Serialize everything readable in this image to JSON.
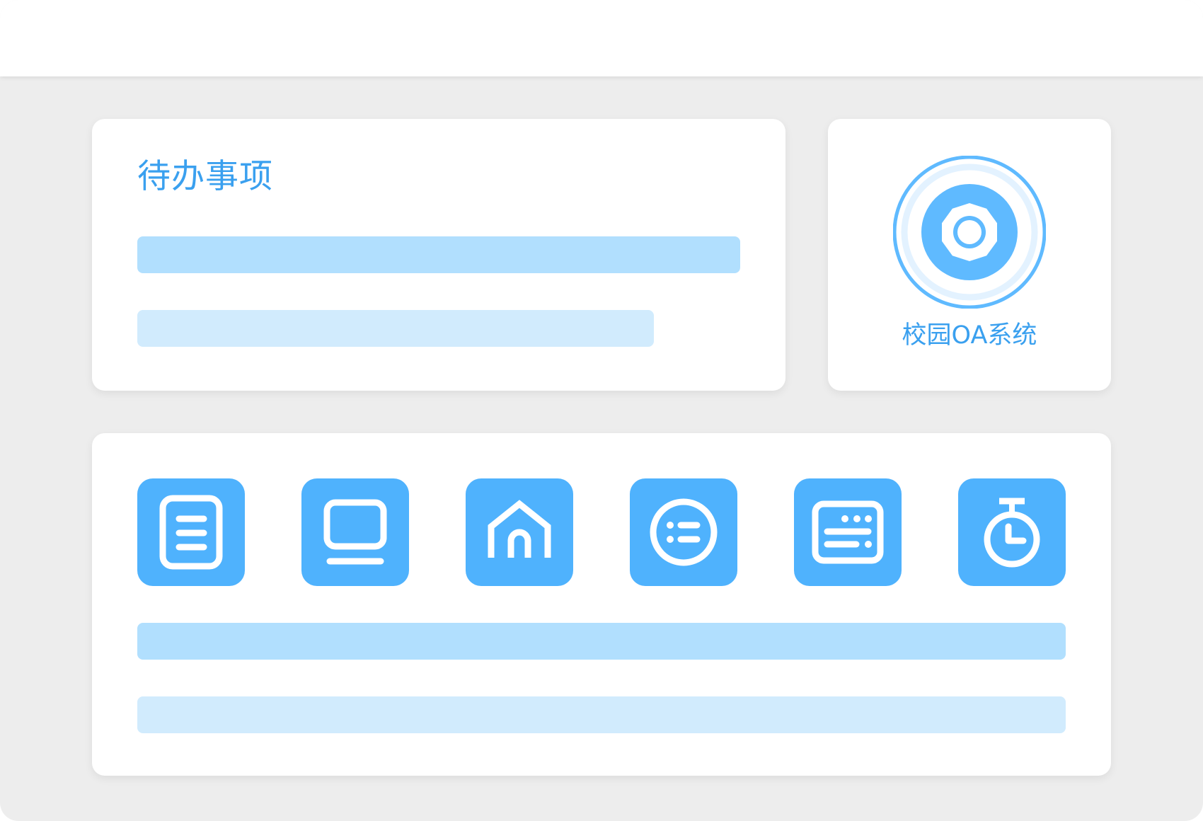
{
  "todo_card": {
    "title": "待办事项"
  },
  "oa_card": {
    "label": "校园OA系统",
    "icon": "octagon-ring-logo-icon"
  },
  "apps": [
    {
      "icon": "document-list-icon"
    },
    {
      "icon": "laptop-icon"
    },
    {
      "icon": "home-icon"
    },
    {
      "icon": "circle-list-icon"
    },
    {
      "icon": "keyboard-icon"
    },
    {
      "icon": "stopwatch-icon"
    }
  ],
  "colors": {
    "accent": "#3aa0ef",
    "tile": "#4fb2fd",
    "bar_dark": "#b1dffe",
    "bar_light": "#d1ebfd",
    "background": "#ededed",
    "card": "#ffffff"
  }
}
